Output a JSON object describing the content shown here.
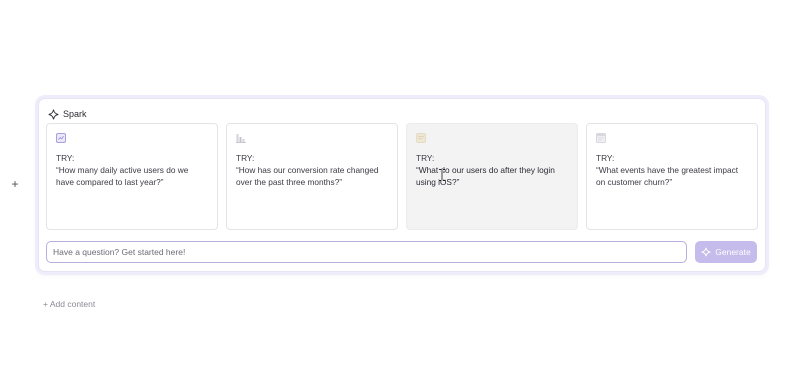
{
  "block_handle": {
    "icon": "plus-icon",
    "label": "+"
  },
  "spark": {
    "icon": "sparkle-icon",
    "title": "Spark",
    "cards": [
      {
        "icon": "chart-icon",
        "try_label": "TRY:",
        "prompt": "“How many daily active users do we have compared to last year?”",
        "color": "#a99ee0"
      },
      {
        "icon": "bar-chart-icon",
        "try_label": "TRY:",
        "prompt": "“How has our conversion rate changed over the past three months?”",
        "color": "#c4c4cc"
      },
      {
        "icon": "document-icon",
        "try_label": "TRY:",
        "prompt": "“What do our users do after they login using iOS?”",
        "color": "#e6dcc6"
      },
      {
        "icon": "table-icon",
        "try_label": "TRY:",
        "prompt": "“What events have the greatest impact on customer churn?”",
        "color": "#d8d8de"
      }
    ],
    "input": {
      "value": "",
      "placeholder": "Have a question? Get started here!"
    },
    "generate": {
      "label": "Generate",
      "icon": "sparkle-icon"
    }
  },
  "add_content": {
    "label": "+ Add content"
  },
  "colors": {
    "accent": "#c5bcec",
    "input_border": "#b8addd",
    "panel_glow": "#efecfb"
  }
}
